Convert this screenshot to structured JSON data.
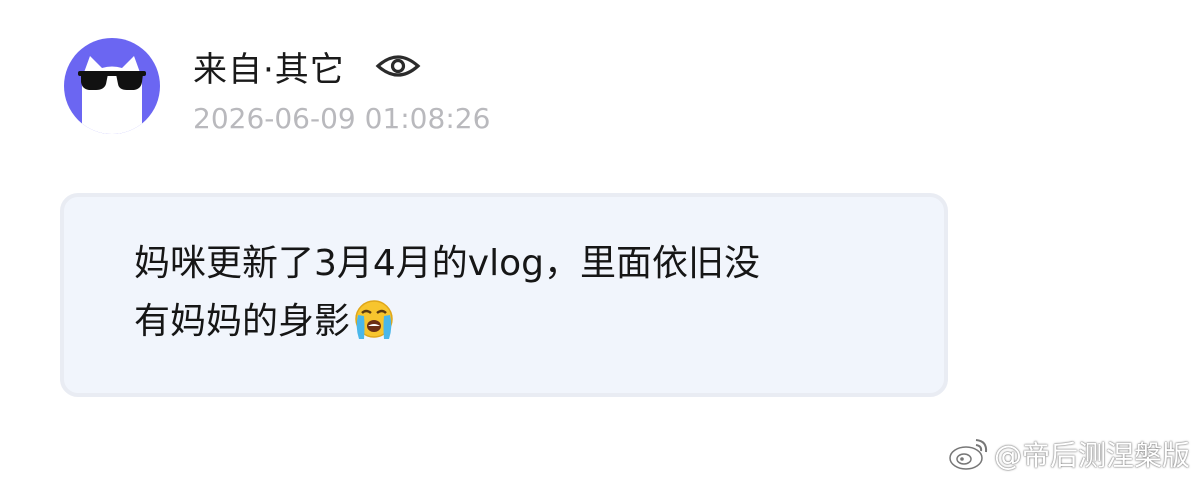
{
  "post": {
    "author": "来自·其它",
    "timestamp": "2026-06-09 01:08:26",
    "message_line1": "妈咪更新了3月4月的vlog，里面依旧没",
    "message_line2": "有妈妈的身影"
  },
  "icons": {
    "avatar": "cat-with-sunglasses-avatar",
    "visibility": "eye-icon",
    "emoji": "loudly-crying-face",
    "watermark_logo": "weibo-logo"
  },
  "watermark": {
    "text": "@帝后测涅槃版"
  },
  "colors": {
    "avatar_bg": "#6b66f2",
    "bubble_bg": "#f1f5fc",
    "timestamp": "#b9b9bd"
  }
}
